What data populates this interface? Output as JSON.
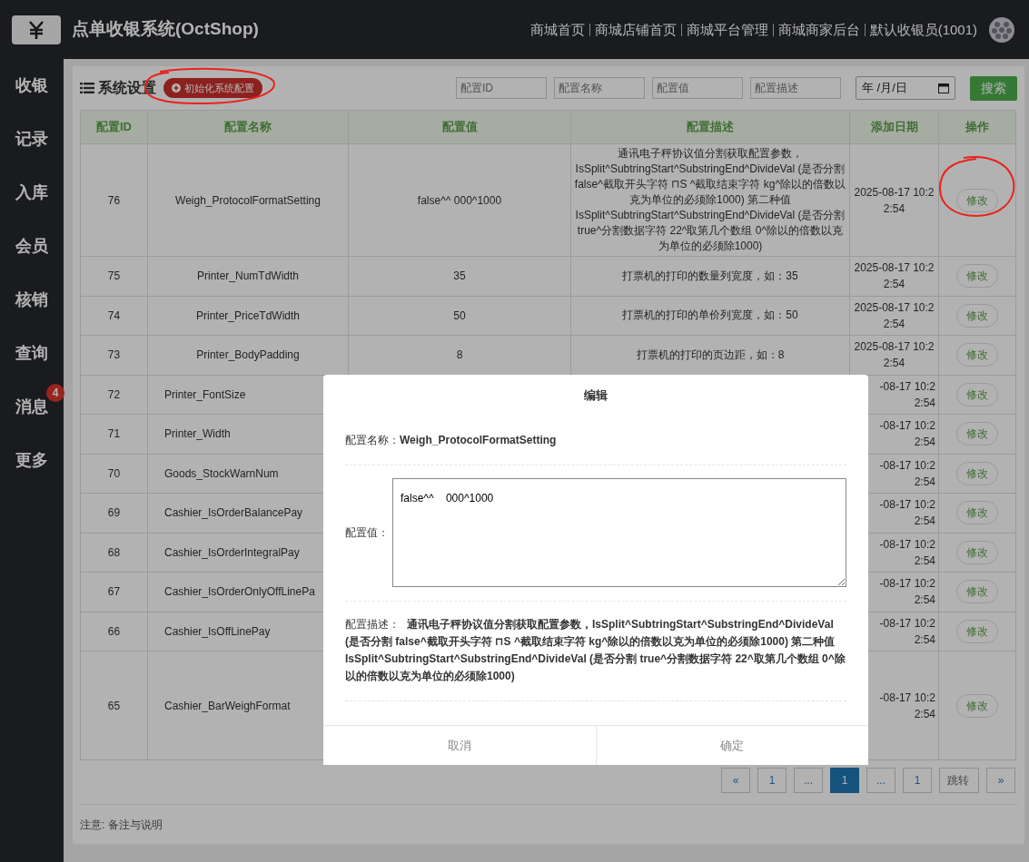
{
  "header": {
    "title": "点单收银系统(OctShop)",
    "links": [
      "商城首页",
      "商城店铺首页",
      "商城平台管理",
      "商城商家后台",
      "默认收银员(1001)"
    ]
  },
  "sidebar": {
    "items": [
      {
        "label": "收银"
      },
      {
        "label": "记录"
      },
      {
        "label": "入库"
      },
      {
        "label": "会员"
      },
      {
        "label": "核销"
      },
      {
        "label": "查询"
      },
      {
        "label": "消息",
        "badge": "4"
      },
      {
        "label": "更多"
      }
    ]
  },
  "toolbar": {
    "title": "系统设置",
    "init_button": "初始化系统配置",
    "filters": [
      {
        "placeholder": "配置ID"
      },
      {
        "placeholder": "配置名称"
      },
      {
        "placeholder": "配置值"
      },
      {
        "placeholder": "配置描述"
      }
    ],
    "date_placeholder": "年 /月/日",
    "search_button": "搜索"
  },
  "table": {
    "columns": [
      "配置ID",
      "配置名称",
      "配置值",
      "配置描述",
      "添加日期",
      "操作"
    ],
    "rows": [
      {
        "id": "76",
        "name": "Weigh_ProtocolFormatSetting",
        "value": "false^^ 000^1000",
        "description": "通讯电子秤协议值分割获取配置参数，IsSplit^SubtringStart^SubstringEnd^DivideVal (是否分割 false^截取开头字符 ⊓S ^截取结束字符 kg^除以的倍数以克为单位的必须除1000) 第二种值 IsSplit^SubtringStart^SubstringEnd^DivideVal (是否分割 true^分割数据字符 22^取第几个数组 0^除以的倍数以克为单位的必须除1000)",
        "date": [
          "2025-08-17 10:2",
          "2:54"
        ],
        "action": "修改"
      },
      {
        "id": "75",
        "name": "Printer_NumTdWidth",
        "value": "35",
        "description": "打票机的打印的数量列宽度，如：35",
        "date": [
          "2025-08-17 10:2",
          "2:54"
        ],
        "action": "修改"
      },
      {
        "id": "74",
        "name": "Printer_PriceTdWidth",
        "value": "50",
        "description": "打票机的打印的单价列宽度，如：50",
        "date": [
          "2025-08-17 10:2",
          "2:54"
        ],
        "action": "修改"
      },
      {
        "id": "73",
        "name": "Printer_BodyPadding",
        "value": "8",
        "description": "打票机的打印的页边距，如：8",
        "date": [
          "2025-08-17 10:2",
          "2:54"
        ],
        "action": "修改"
      },
      {
        "id": "72",
        "name": "Printer_FontSize",
        "date": [
          "-08-17 10:2",
          "2:54"
        ],
        "action": "修改"
      },
      {
        "id": "71",
        "name": "Printer_Width",
        "date": [
          "-08-17 10:2",
          "2:54"
        ],
        "action": "修改"
      },
      {
        "id": "70",
        "name": "Goods_StockWarnNum",
        "date": [
          "-08-17 10:2",
          "2:54"
        ],
        "action": "修改"
      },
      {
        "id": "69",
        "name": "Cashier_IsOrderBalancePay",
        "date": [
          "-08-17 10:2",
          "2:54"
        ],
        "action": "修改"
      },
      {
        "id": "68",
        "name": "Cashier_IsOrderIntegralPay",
        "date": [
          "-08-17 10:2",
          "2:54"
        ],
        "action": "修改"
      },
      {
        "id": "67",
        "name": "Cashier_IsOrderOnlyOffLinePa",
        "date": [
          "-08-17 10:2",
          "2:54"
        ],
        "action": "修改"
      },
      {
        "id": "66",
        "name": "Cashier_IsOffLinePay",
        "date": [
          "-08-17 10:2",
          "2:54"
        ],
        "action": "修改"
      },
      {
        "id": "65",
        "name": "Cashier_BarWeighFormat",
        "date": [
          "-08-17 10:2",
          "2:54"
        ],
        "action": "修改"
      }
    ]
  },
  "pagination": [
    {
      "label": "«",
      "selected": false
    },
    {
      "label": "1",
      "selected": false
    },
    {
      "label": "...",
      "selected": false
    },
    {
      "label": "1",
      "selected": true
    },
    {
      "label": "...",
      "selected": false
    },
    {
      "label": "1",
      "selected": false
    },
    {
      "label": "跳转",
      "selected": false,
      "kind": "jump"
    },
    {
      "label": "»",
      "selected": false
    }
  ],
  "footer_note": "注意: 备注与说明",
  "modal": {
    "title": "编辑",
    "name_label": "配置名称：",
    "name_value": "Weigh_ProtocolFormatSetting",
    "value_label": "配置值：",
    "value": "false^^    000^1000",
    "description_label": "配置描述：",
    "description": "通讯电子秤协议值分割获取配置参数，IsSplit^SubtringStart^SubstringEnd^DivideVal (是否分割 false^截取开头字符 ⊓S ^截取结束字符 kg^除以的倍数以克为单位的必须除1000) 第二种值 IsSplit^SubtringStart^SubstringEnd^DivideVal (是否分割 true^分割数据字符 22^取第几个数组 0^除以的倍数以克为单位的必须除1000)",
    "buttons": [
      "取消",
      "确定"
    ]
  }
}
